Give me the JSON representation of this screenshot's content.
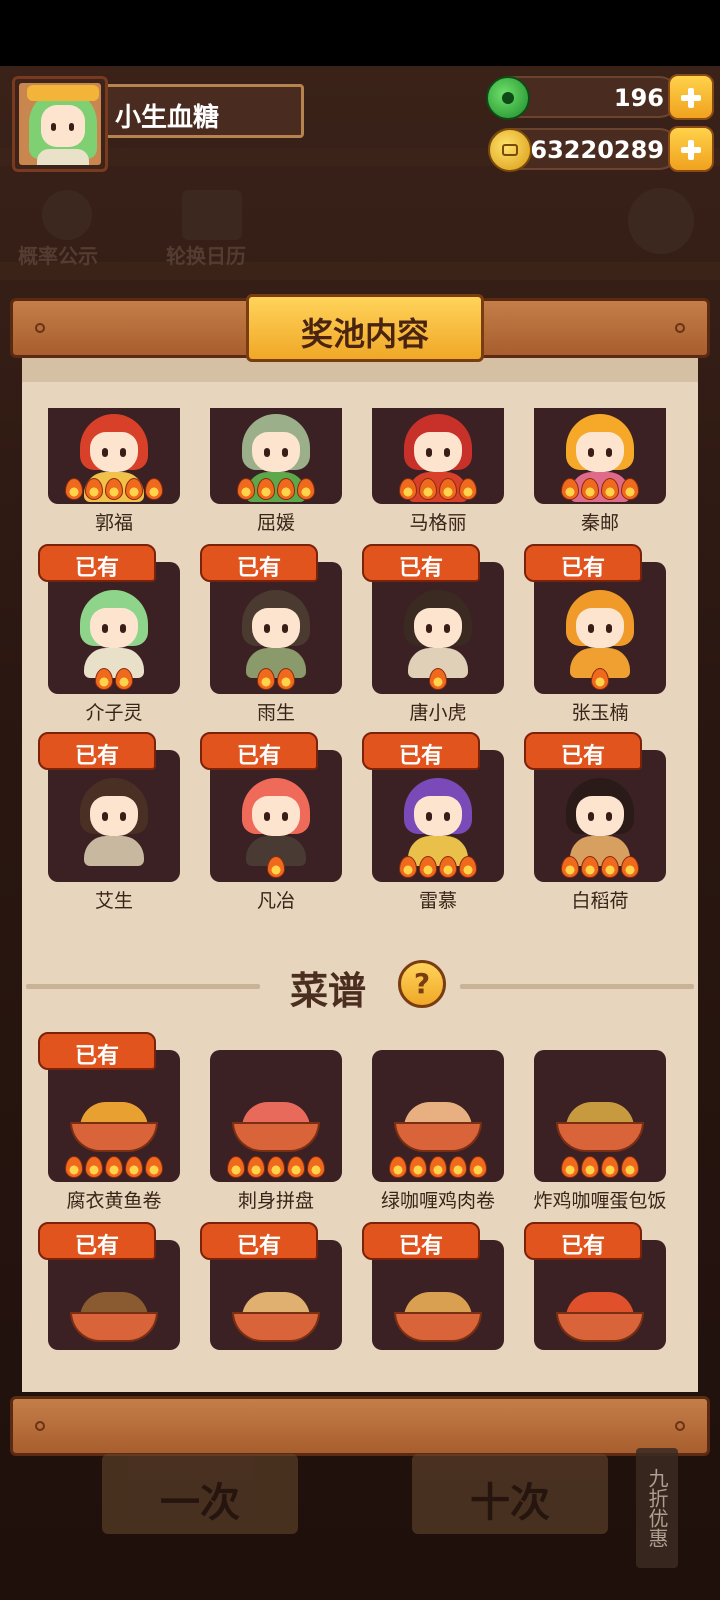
{
  "player": {
    "name": "小生血糖",
    "avatar_icon": "girl-avatar-icon"
  },
  "currency": {
    "jade": {
      "value": "196",
      "icon": "jade-icon"
    },
    "gold": {
      "value": "63220289",
      "icon": "coin-icon"
    }
  },
  "shortcuts": {
    "probability": "概率公示",
    "calendar": "轮换日历"
  },
  "panel": {
    "title": "奖池内容",
    "recipes_title": "菜谱",
    "help_symbol": "?"
  },
  "owned_label": "已有",
  "characters": [
    {
      "name": "郭福",
      "owned": false,
      "stars": 5,
      "hair": "#d8402a",
      "outfit": "#f0c24a"
    },
    {
      "name": "屈媛",
      "owned": false,
      "stars": 4,
      "hair": "#9bb08a",
      "outfit": "#5ca84a"
    },
    {
      "name": "马格丽",
      "owned": false,
      "stars": 4,
      "hair": "#c8302a",
      "outfit": "#d8402a"
    },
    {
      "name": "秦邮",
      "owned": false,
      "stars": 4,
      "hair": "#f6a928",
      "outfit": "#e06a8a"
    },
    {
      "name": "介子灵",
      "owned": true,
      "stars": 2,
      "hair": "#8ed48a",
      "outfit": "#e8e0c8"
    },
    {
      "name": "雨生",
      "owned": true,
      "stars": 2,
      "hair": "#4a3a30",
      "outfit": "#8a9a6a"
    },
    {
      "name": "唐小虎",
      "owned": true,
      "stars": 1,
      "hair": "#3a2a22",
      "outfit": "#e0d0b8"
    },
    {
      "name": "张玉楠",
      "owned": true,
      "stars": 1,
      "hair": "#f09a2a",
      "outfit": "#f0a030"
    },
    {
      "name": "艾生",
      "owned": true,
      "stars": 0,
      "hair": "#4a3024",
      "outfit": "#c8b8a0"
    },
    {
      "name": "凡冶",
      "owned": true,
      "stars": 1,
      "hair": "#f06a5a",
      "outfit": "#4a3a34"
    },
    {
      "name": "雷慕",
      "owned": true,
      "stars": 4,
      "hair": "#7a4ab8",
      "outfit": "#e8c04a"
    },
    {
      "name": "白稻荷",
      "owned": true,
      "stars": 4,
      "hair": "#2a1a18",
      "outfit": "#d8a060"
    }
  ],
  "recipes": [
    {
      "name": "腐衣黄鱼卷",
      "owned": true,
      "stars": 5,
      "food": "#e8a030"
    },
    {
      "name": "刺身拼盘",
      "owned": false,
      "stars": 5,
      "food": "#e86a5a"
    },
    {
      "name": "绿咖喱鸡肉卷",
      "owned": false,
      "stars": 5,
      "food": "#e8b080"
    },
    {
      "name": "炸鸡咖喱蛋包饭",
      "owned": false,
      "stars": 4,
      "food": "#c89a40"
    },
    {
      "name": "",
      "owned": true,
      "stars": 0,
      "food": "#8a5a30"
    },
    {
      "name": "",
      "owned": true,
      "stars": 0,
      "food": "#e0b070"
    },
    {
      "name": "",
      "owned": true,
      "stars": 0,
      "food": "#d8a050"
    },
    {
      "name": "",
      "owned": true,
      "stars": 0,
      "food": "#e0502a"
    }
  ],
  "bottom": {
    "single_draw": "一次",
    "ten_draw": "十次",
    "discount": "九折优惠"
  }
}
